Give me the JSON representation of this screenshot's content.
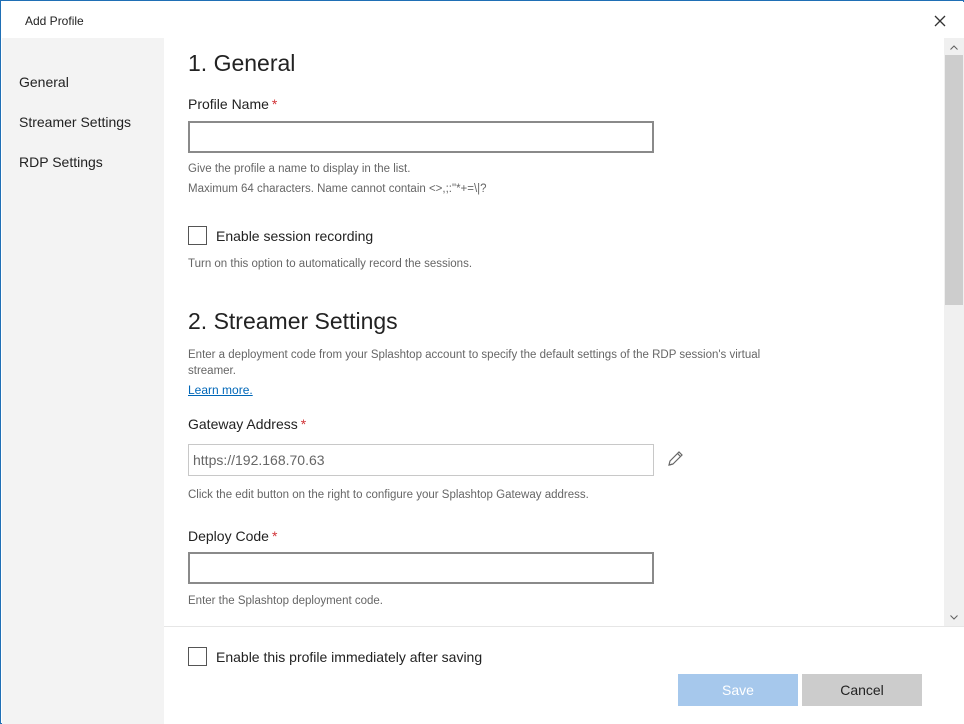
{
  "window": {
    "title": "Add Profile"
  },
  "sidebar": {
    "items": [
      {
        "label": "General"
      },
      {
        "label": "Streamer Settings"
      },
      {
        "label": "RDP Settings"
      }
    ]
  },
  "general": {
    "title": "1. General",
    "profile_name_label": "Profile Name",
    "required_mark": "*",
    "profile_name_value": "",
    "profile_name_help_1": "Give the profile a name to display in the list.",
    "profile_name_help_2": "Maximum 64 characters. Name cannot contain <>,;:\"*+=\\|?",
    "session_recording_label": "Enable session recording",
    "session_recording_checked": false,
    "session_recording_help": "Turn on this option to automatically record the sessions."
  },
  "streamer": {
    "title": "2. Streamer Settings",
    "description": "Enter a deployment code from your Splashtop account to specify the default settings of the RDP session's virtual streamer.",
    "learn_more": "Learn more.",
    "gateway_label": "Gateway Address",
    "gateway_value": "https://192.168.70.63",
    "gateway_help": "Click the edit button on the right to configure your Splashtop Gateway address.",
    "deploy_label": "Deploy Code",
    "deploy_value": "",
    "deploy_help": "Enter the Splashtop deployment code."
  },
  "footer": {
    "enable_label": "Enable this profile immediately after saving",
    "enable_checked": false,
    "save_label": "Save",
    "cancel_label": "Cancel"
  },
  "colors": {
    "accent": "#0067b8",
    "required": "#d13438",
    "save_disabled": "#a6c8ec",
    "cancel_bg": "#cccccc",
    "sidebar_bg": "#f3f3f3"
  },
  "icons": {
    "close": "close-icon",
    "edit": "pencil-icon",
    "scroll_up": "chevron-up-icon",
    "scroll_down": "chevron-down-icon"
  }
}
